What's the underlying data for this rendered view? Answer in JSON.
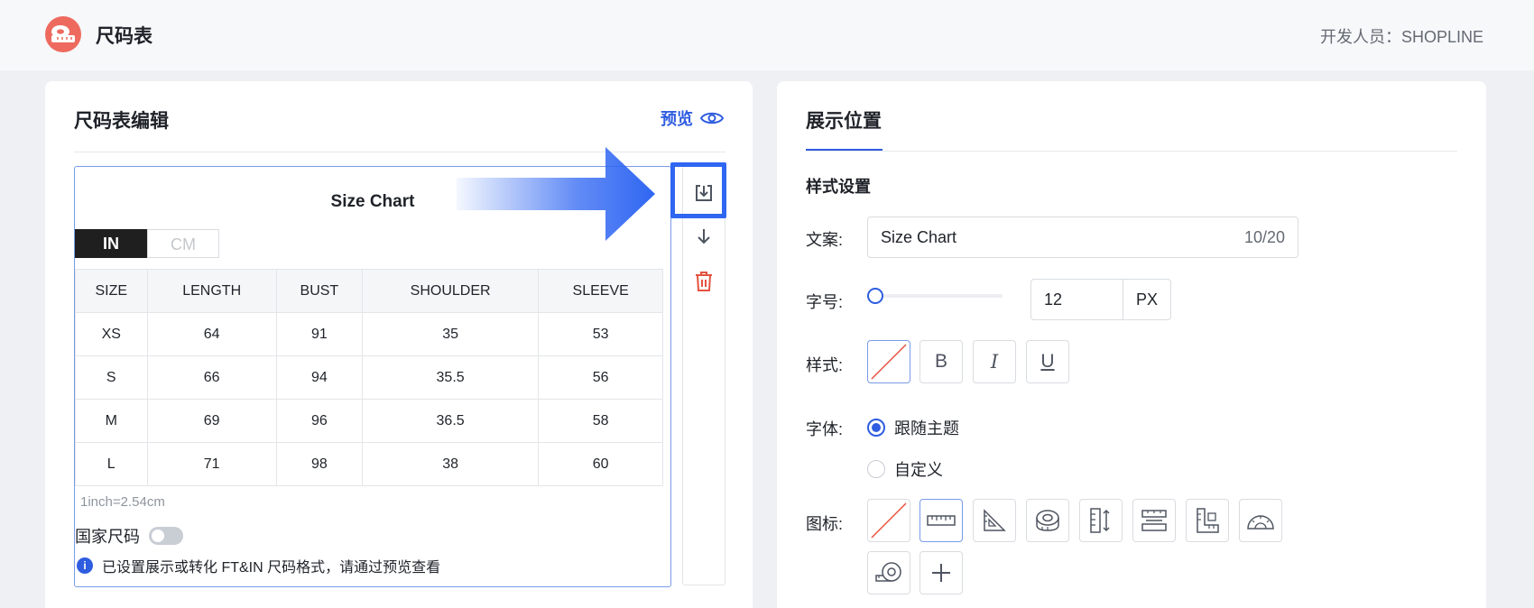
{
  "header": {
    "app_title": "尺码表",
    "developer": "开发人员：SHOPLINE"
  },
  "editor": {
    "card_title": "尺码表编辑",
    "preview_label": "预览",
    "chart_title": "Size Chart",
    "units": [
      "IN",
      "CM"
    ],
    "active_unit": "IN",
    "columns": [
      "SIZE",
      "LENGTH",
      "BUST",
      "SHOULDER",
      "SLEEVE"
    ],
    "rows": [
      [
        "XS",
        "64",
        "91",
        "35",
        "53"
      ],
      [
        "S",
        "66",
        "94",
        "35.5",
        "56"
      ],
      [
        "M",
        "69",
        "96",
        "36.5",
        "58"
      ],
      [
        "L",
        "71",
        "98",
        "38",
        "60"
      ]
    ],
    "conversion_note": "1inch=2.54cm",
    "country_size_label": "国家尺码",
    "country_size_enabled": false,
    "info_text": "已设置展示或转化 FT&IN 尺码格式，请通过预览查看",
    "tools": [
      "import-icon",
      "move-down-icon",
      "delete-icon"
    ]
  },
  "display": {
    "card_title": "展示位置",
    "section_title": "样式设置",
    "text_label": "文案:",
    "text_value": "Size Chart",
    "text_count": "10/20",
    "font_size_label": "字号:",
    "font_size_value": "12",
    "font_size_unit": "PX",
    "style_label": "样式:",
    "style_buttons": [
      "none",
      "B",
      "I",
      "U"
    ],
    "font_label": "字体:",
    "font_options": [
      "跟随主题",
      "自定义"
    ],
    "font_selected": "跟随主题",
    "icon_label": "图标:",
    "icons": [
      "none-icon",
      "ruler-icon",
      "triangle-ruler-icon",
      "tape-measure-icon",
      "height-ruler-icon",
      "size-guide-icon",
      "l-ruler-icon",
      "protractor-icon",
      "tape-roll-icon",
      "add-icon"
    ],
    "selected_icon": "ruler-icon"
  },
  "colors": {
    "accent": "#2f5de0",
    "highlight": "#2f66f2",
    "logo": "#ee6a5f",
    "delete": "#e5533f"
  }
}
